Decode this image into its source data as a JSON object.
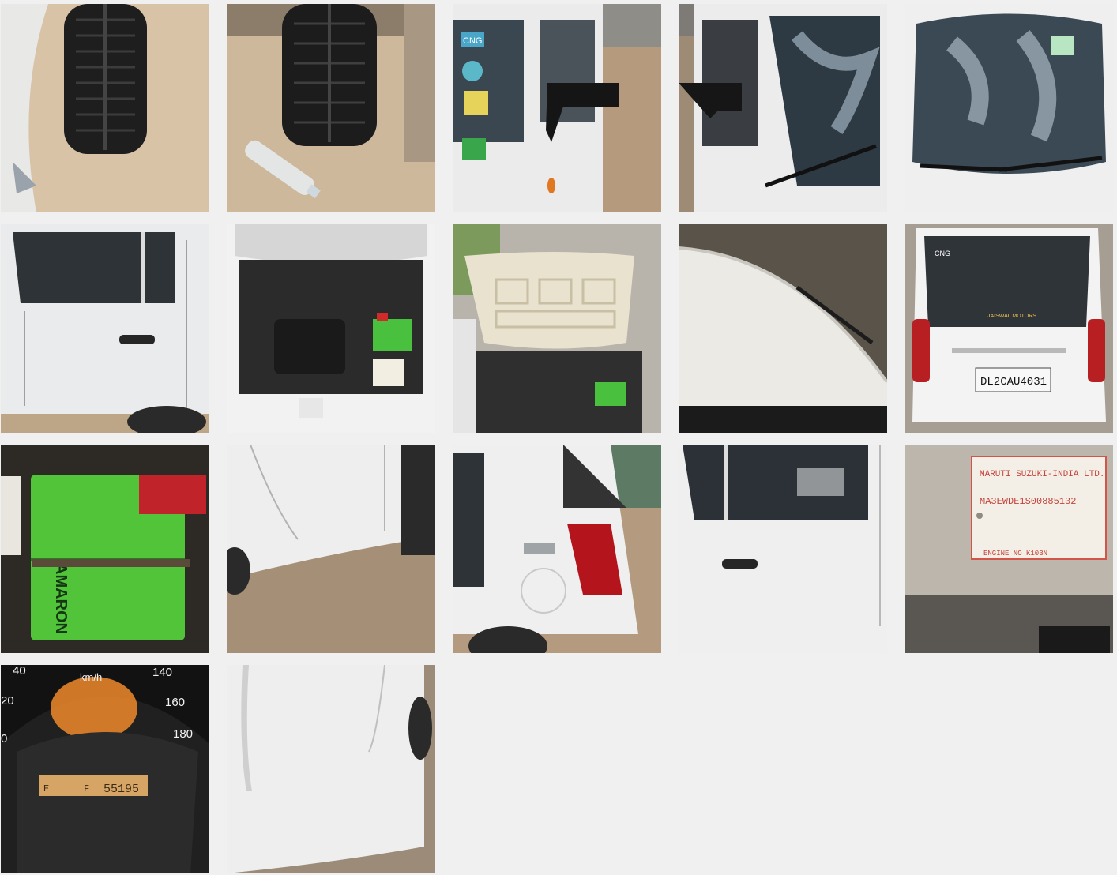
{
  "gallery": {
    "photos": [
      {
        "subject": "front-tyre-closeup"
      },
      {
        "subject": "rear-tyre-with-bottle"
      },
      {
        "subject": "front-left-door-mirror",
        "sticker_text": "CNG"
      },
      {
        "subject": "front-right-door-windshield"
      },
      {
        "subject": "front-windshield-wipers"
      },
      {
        "subject": "left-side-doors"
      },
      {
        "subject": "engine-bay-open-hood"
      },
      {
        "subject": "open-hood-underside"
      },
      {
        "subject": "roof-closeup"
      },
      {
        "subject": "rear-view-number-plate",
        "dealer_text": "JAISWAL MOTORS",
        "plate_text": "DL2CAU4031",
        "badge_text": "CNG"
      },
      {
        "subject": "battery-closeup",
        "battery_brand": "AMARON"
      },
      {
        "subject": "right-side-lower-panel"
      },
      {
        "subject": "rear-taillight-fuel-lid"
      },
      {
        "subject": "right-rear-door"
      },
      {
        "subject": "vin-plate",
        "maker_text": "MARUTI SUZUKI-INDIA LTD.",
        "vin_text": "MA3EWDE1S00885132",
        "engine_text": "ENGINE NO K10BN"
      },
      {
        "subject": "speedometer-odometer",
        "unit_text": "km/h",
        "speed_ticks": [
          "40",
          "20",
          "0",
          "140",
          "160",
          "180"
        ],
        "odometer_text": "55195",
        "fuel_label_e": "E",
        "fuel_label_f": "F"
      },
      {
        "subject": "left-door-panel"
      }
    ]
  }
}
